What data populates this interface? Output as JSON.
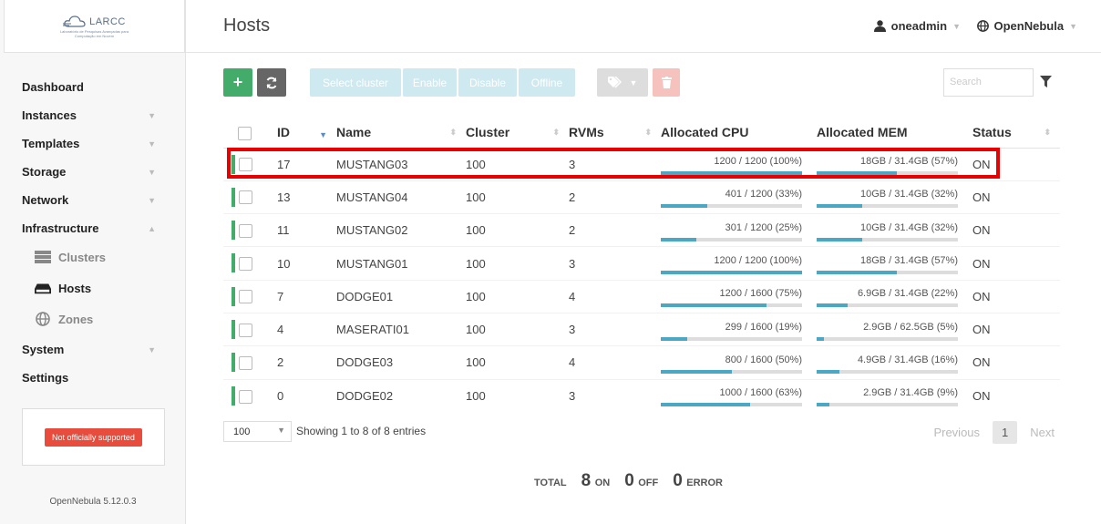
{
  "brand": {
    "name": "LARCC",
    "subtitle": "Laboratório de Pesquisas Avançadas para Computação em Nuvem"
  },
  "sidebar": {
    "items": [
      {
        "label": "Dashboard"
      },
      {
        "label": "Instances"
      },
      {
        "label": "Templates"
      },
      {
        "label": "Storage"
      },
      {
        "label": "Network"
      },
      {
        "label": "Infrastructure"
      }
    ],
    "sub_items": [
      {
        "label": "Clusters",
        "icon": "server-icon"
      },
      {
        "label": "Hosts",
        "icon": "hdd-icon"
      },
      {
        "label": "Zones",
        "icon": "globe-icon"
      }
    ],
    "after_items": [
      {
        "label": "System"
      },
      {
        "label": "Settings"
      }
    ],
    "support_label": "Not officially supported",
    "version": "OpenNebula 5.12.0.3"
  },
  "header": {
    "title": "Hosts",
    "user": "oneadmin",
    "zone": "OpenNebula"
  },
  "toolbar": {
    "select_cluster": "Select cluster",
    "enable": "Enable",
    "disable": "Disable",
    "offline": "Offline",
    "search_placeholder": "Search",
    "colors": {
      "add": "#43ac6a",
      "refresh": "#666666",
      "light": "#cfe9f0",
      "delete": "#f5c2bd"
    }
  },
  "table": {
    "columns": [
      "ID",
      "Name",
      "Cluster",
      "RVMs",
      "Allocated CPU",
      "Allocated MEM",
      "Status"
    ],
    "rows": [
      {
        "id": "17",
        "name": "MUSTANG03",
        "cluster": "100",
        "rvms": "3",
        "cpu": "1200 / 1200 (100%)",
        "cpu_pct": 100,
        "mem": "18GB / 31.4GB (57%)",
        "mem_pct": 57,
        "status": "ON"
      },
      {
        "id": "13",
        "name": "MUSTANG04",
        "cluster": "100",
        "rvms": "2",
        "cpu": "401 / 1200 (33%)",
        "cpu_pct": 33,
        "mem": "10GB / 31.4GB (32%)",
        "mem_pct": 32,
        "status": "ON"
      },
      {
        "id": "11",
        "name": "MUSTANG02",
        "cluster": "100",
        "rvms": "2",
        "cpu": "301 / 1200 (25%)",
        "cpu_pct": 25,
        "mem": "10GB / 31.4GB (32%)",
        "mem_pct": 32,
        "status": "ON"
      },
      {
        "id": "10",
        "name": "MUSTANG01",
        "cluster": "100",
        "rvms": "3",
        "cpu": "1200 / 1200 (100%)",
        "cpu_pct": 100,
        "mem": "18GB / 31.4GB (57%)",
        "mem_pct": 57,
        "status": "ON"
      },
      {
        "id": "7",
        "name": "DODGE01",
        "cluster": "100",
        "rvms": "4",
        "cpu": "1200 / 1600 (75%)",
        "cpu_pct": 75,
        "mem": "6.9GB / 31.4GB (22%)",
        "mem_pct": 22,
        "status": "ON"
      },
      {
        "id": "4",
        "name": "MASERATI01",
        "cluster": "100",
        "rvms": "3",
        "cpu": "299 / 1600 (19%)",
        "cpu_pct": 19,
        "mem": "2.9GB / 62.5GB (5%)",
        "mem_pct": 5,
        "status": "ON"
      },
      {
        "id": "2",
        "name": "DODGE03",
        "cluster": "100",
        "rvms": "4",
        "cpu": "800 / 1600 (50%)",
        "cpu_pct": 50,
        "mem": "4.9GB / 31.4GB (16%)",
        "mem_pct": 16,
        "status": "ON"
      },
      {
        "id": "0",
        "name": "DODGE02",
        "cluster": "100",
        "rvms": "3",
        "cpu": "1000 / 1600 (63%)",
        "cpu_pct": 63,
        "mem": "2.9GB / 31.4GB (9%)",
        "mem_pct": 9,
        "status": "ON"
      }
    ]
  },
  "footer": {
    "page_length": "100",
    "info": "Showing 1 to 8 of 8 entries",
    "previous": "Previous",
    "page": "1",
    "next": "Next"
  },
  "totals": {
    "label": "TOTAL",
    "on_count": "8",
    "on_label": "ON",
    "off_count": "0",
    "off_label": "OFF",
    "error_count": "0",
    "error_label": "ERROR"
  }
}
